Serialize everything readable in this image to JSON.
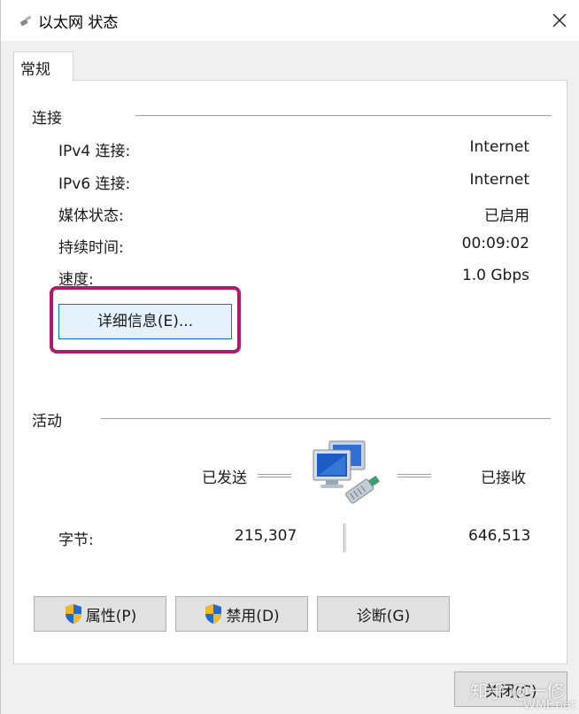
{
  "window": {
    "title": "以太网 状态",
    "close_glyph": "✕"
  },
  "tabs": [
    {
      "label": "常规",
      "active": true
    }
  ],
  "connection": {
    "group_label": "连接",
    "rows": [
      {
        "label": "IPv4 连接:",
        "value": "Internet"
      },
      {
        "label": "IPv6 连接:",
        "value": "Internet"
      },
      {
        "label": "媒体状态:",
        "value": "已启用"
      },
      {
        "label": "持续时间:",
        "value": "00:09:02"
      },
      {
        "label": "速度:",
        "value": "1.0 Gbps"
      }
    ],
    "details_button": "详细信息(E)..."
  },
  "activity": {
    "group_label": "活动",
    "sent_label": "已发送",
    "received_label": "已接收",
    "bytes_label": "字节:",
    "bytes_sent": "215,307",
    "bytes_received": "646,513"
  },
  "buttons": {
    "properties": "属性(P)",
    "disable": "禁用(D)",
    "diagnose": "诊断(G)",
    "close": "关闭(C)"
  },
  "watermark": {
    "text": "知乎 @一修",
    "subtext": "WMF.net"
  },
  "colors": {
    "highlight": "#b5176a",
    "button_focus_border": "#0078d7",
    "button_focus_bg": "#e5f1fb"
  }
}
